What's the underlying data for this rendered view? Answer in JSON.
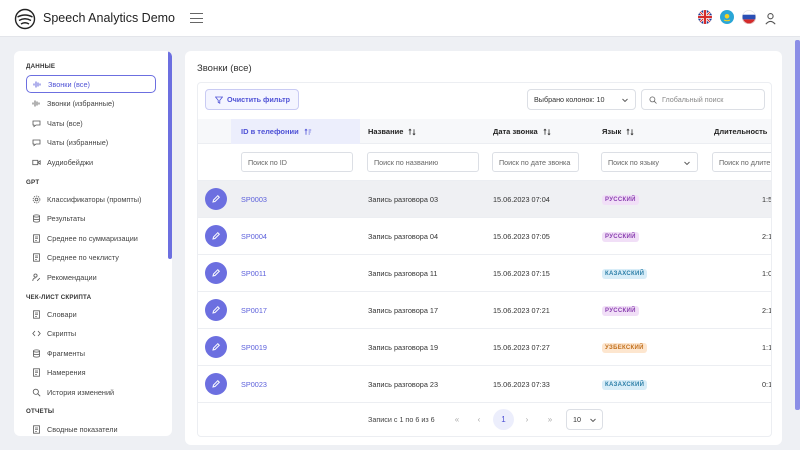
{
  "app": {
    "title": "Speech Analytics Demo"
  },
  "header": {
    "languages": [
      {
        "code": "en",
        "icon": "flag-gb-icon"
      },
      {
        "code": "kz",
        "icon": "flag-kz-icon"
      },
      {
        "code": "ru",
        "icon": "flag-ru-icon"
      }
    ]
  },
  "sidebar": {
    "sections": [
      {
        "title": "ДАННЫЕ"
      },
      {
        "title": "GPT"
      },
      {
        "title": "ЧЕК-ЛИСТ СКРИПТА"
      },
      {
        "title": "ОТЧЕТЫ"
      }
    ],
    "items": [
      {
        "label": "Звонки (все)",
        "icon": "waveform-icon",
        "active": true
      },
      {
        "label": "Звонки (избранные)",
        "icon": "waveform-icon"
      },
      {
        "label": "Чаты (все)",
        "icon": "chat-icon"
      },
      {
        "label": "Чаты (избранные)",
        "icon": "chat-icon"
      },
      {
        "label": "Аудиобейджи",
        "icon": "video-icon"
      },
      {
        "label": "Классификаторы (промпты)",
        "icon": "gear-icon"
      },
      {
        "label": "Результаты",
        "icon": "database-icon"
      },
      {
        "label": "Среднее по суммаризации",
        "icon": "document-icon"
      },
      {
        "label": "Среднее по чеклисту",
        "icon": "document-icon"
      },
      {
        "label": "Рекомендации",
        "icon": "user-edit-icon"
      },
      {
        "label": "Словари",
        "icon": "document-icon"
      },
      {
        "label": "Скрипты",
        "icon": "code-icon"
      },
      {
        "label": "Фрагменты",
        "icon": "database-icon"
      },
      {
        "label": "Намерения",
        "icon": "document-icon"
      },
      {
        "label": "История изменений",
        "icon": "search-icon"
      },
      {
        "label": "Сводные показатели",
        "icon": "document-icon"
      }
    ]
  },
  "main": {
    "title": "Звонки (все)",
    "clear_filter_label": "Очистить фильтр",
    "columns_selected": "Выбрано колонок: 10",
    "global_search_placeholder": "Глобальный поиск",
    "columns": [
      {
        "label": "ID в телефонии",
        "sorted": true
      },
      {
        "label": "Название"
      },
      {
        "label": "Дата звонка"
      },
      {
        "label": "Язык"
      },
      {
        "label": "Длительность"
      }
    ],
    "filters": {
      "id_placeholder": "Поиск по ID",
      "name_placeholder": "Поиск по названию",
      "date_placeholder": "Поиск по дате звонка",
      "language_placeholder": "Поиск по языку",
      "duration_placeholder": "Поиск по длите"
    },
    "rows": [
      {
        "id": "SP0003",
        "name": "Запись разговора 03",
        "date": "15.06.2023 07:04",
        "language": "РУССКИЙ",
        "lang_key": "ru",
        "duration": "1:5"
      },
      {
        "id": "SP0004",
        "name": "Запись разговора 04",
        "date": "15.06.2023 07:05",
        "language": "РУССКИЙ",
        "lang_key": "ru",
        "duration": "2:1"
      },
      {
        "id": "SP0011",
        "name": "Запись разговора 11",
        "date": "15.06.2023 07:15",
        "language": "КАЗАХСКИЙ",
        "lang_key": "kz",
        "duration": "1:0"
      },
      {
        "id": "SP0017",
        "name": "Запись разговора 17",
        "date": "15.06.2023 07:21",
        "language": "РУССКИЙ",
        "lang_key": "ru",
        "duration": "2:1"
      },
      {
        "id": "SP0019",
        "name": "Запись разговора 19",
        "date": "15.06.2023 07:27",
        "language": "УЗБЕКСКИЙ",
        "lang_key": "uz",
        "duration": "1:1"
      },
      {
        "id": "SP0023",
        "name": "Запись разговора 23",
        "date": "15.06.2023 07:33",
        "language": "КАЗАХСКИЙ",
        "lang_key": "kz",
        "duration": "0:1"
      }
    ],
    "hover_row_index": 0,
    "horizontal_scroll_fraction": 0.41,
    "badge_colors": {
      "ru": {
        "bg": "#f1dff7",
        "fg": "#8a3fb0"
      },
      "kz": {
        "bg": "#d8edf8",
        "fg": "#2d7fa8"
      },
      "uz": {
        "bg": "#fde6cf",
        "fg": "#c1701d"
      }
    },
    "paginator": {
      "summary": "Записи с 1 по 6 из 6",
      "current_page": "1",
      "page_size": "10",
      "first": "«",
      "prev": "‹",
      "next": "›",
      "last": "»"
    }
  },
  "colors": {
    "accent": "#6c6fe0",
    "accent_text": "#4f52d6"
  }
}
